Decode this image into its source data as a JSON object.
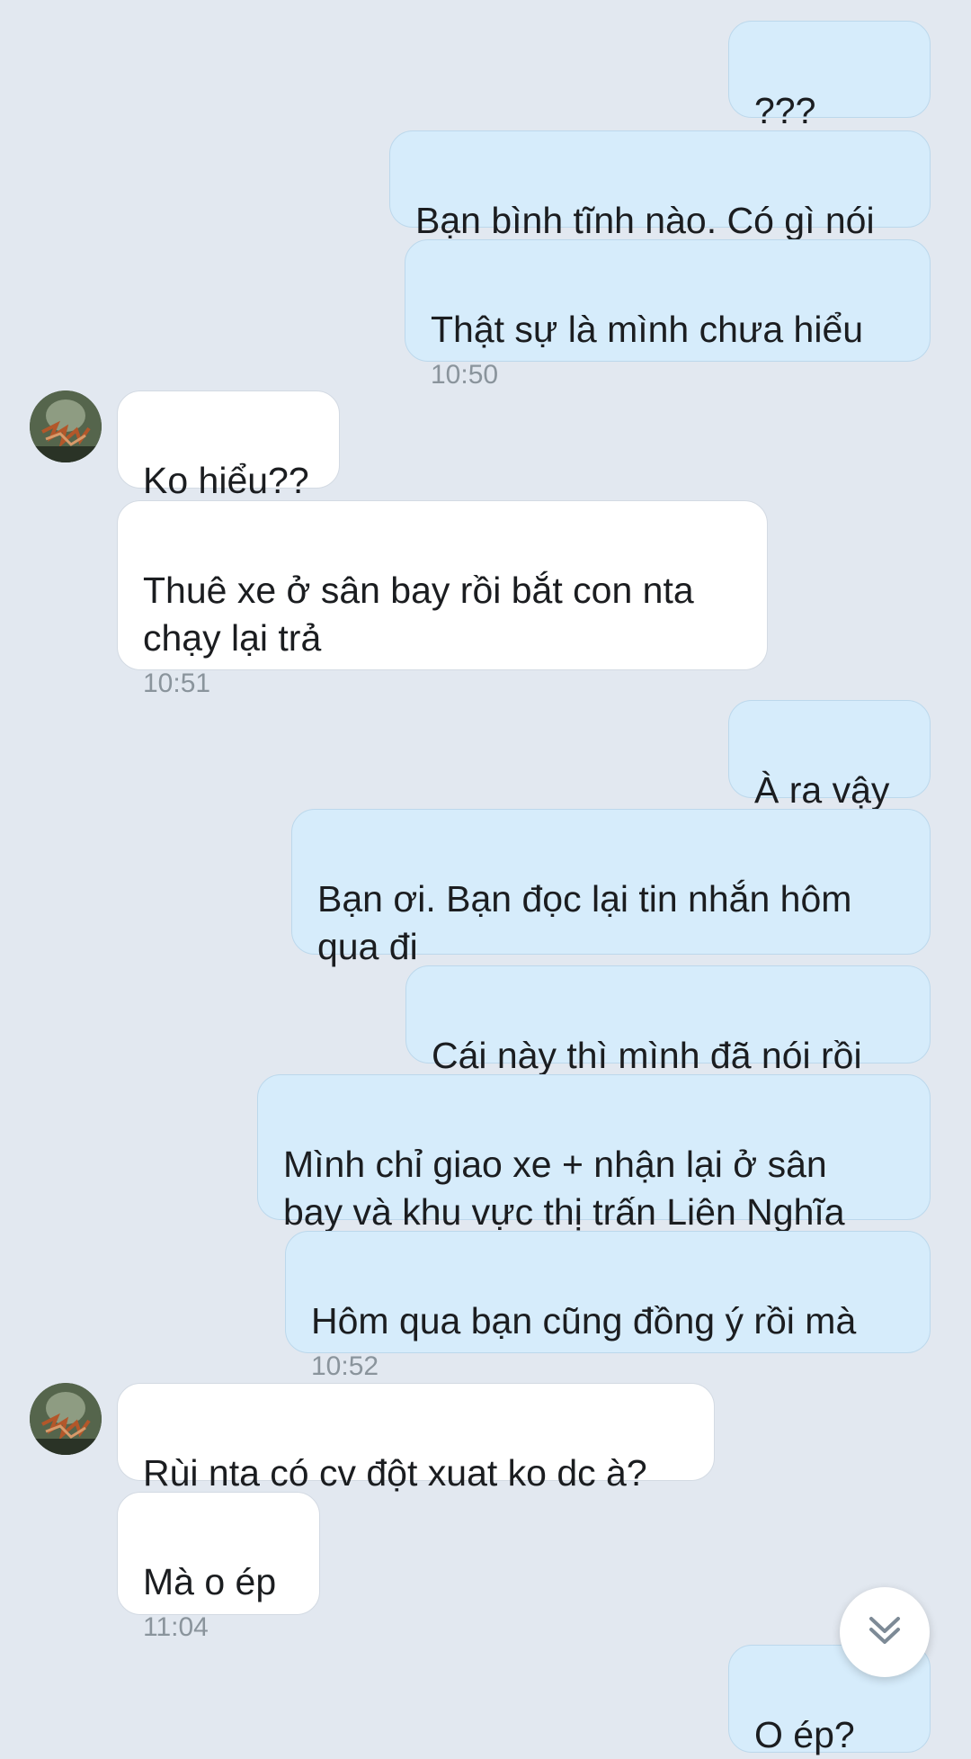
{
  "messages": [
    {
      "text": "???",
      "time": ""
    },
    {
      "text": "Bạn bình tĩnh nào. Có gì nói",
      "time": ""
    },
    {
      "text": "Thật sự là mình chưa hiểu",
      "time": "10:50"
    },
    {
      "text": "Ko hiểu??",
      "time": ""
    },
    {
      "text": "Thuê xe ở sân bay rồi bắt con nta\nchạy lại trả",
      "time": "10:51"
    },
    {
      "text": "À ra vậy",
      "time": ""
    },
    {
      "text": "Bạn ơi. Bạn đọc lại tin nhắn hôm\nqua đi",
      "time": ""
    },
    {
      "text": "Cái này thì mình đã nói rồi",
      "time": ""
    },
    {
      "text": "Mình chỉ giao xe + nhận lại ở sân\nbay và khu vực thị trấn Liên Nghĩa",
      "time": ""
    },
    {
      "text": "Hôm qua bạn cũng đồng ý rồi mà",
      "time": "10:52"
    },
    {
      "text": "Rùi nta có cv đột xuat ko dc à?",
      "time": ""
    },
    {
      "text": "Mà o ép",
      "time": "11:04"
    },
    {
      "text": "O ép?",
      "time": ""
    }
  ],
  "icons": {
    "avatar": "contact-avatar",
    "scroll_down": "double-chevron-down-icon"
  },
  "colors": {
    "background": "#e2e8f0",
    "outgoing_bubble": "#d6ecfb",
    "incoming_bubble": "#ffffff"
  }
}
